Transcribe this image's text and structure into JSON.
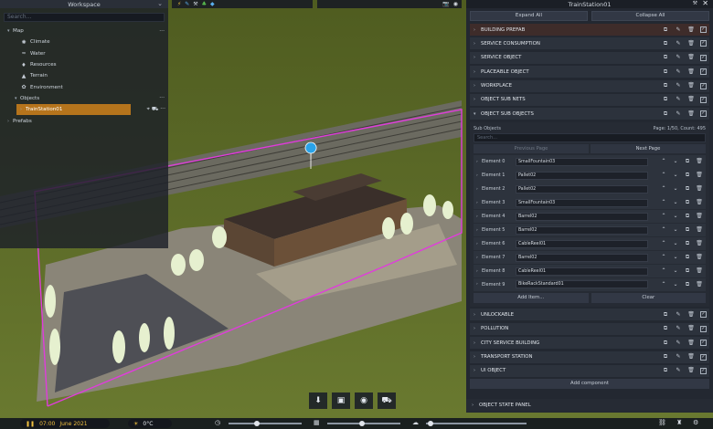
{
  "workspace": {
    "title": "Workspace",
    "search_placeholder": "Search...",
    "tree": [
      {
        "label": "Map",
        "level": 0,
        "arrow": "▾",
        "icon": ""
      },
      {
        "label": "Climate",
        "level": 1,
        "arrow": "",
        "icon": "sun-icon"
      },
      {
        "label": "Water",
        "level": 1,
        "arrow": "",
        "icon": "water-icon"
      },
      {
        "label": "Resources",
        "level": 1,
        "arrow": "",
        "icon": "resources-icon"
      },
      {
        "label": "Terrain",
        "level": 1,
        "arrow": "",
        "icon": "terrain-icon"
      },
      {
        "label": "Environment",
        "level": 1,
        "arrow": "",
        "icon": "environment-icon"
      },
      {
        "label": "Objects",
        "level": 1,
        "arrow": "▾",
        "icon": ""
      },
      {
        "label": "TrainStation01",
        "level": 2,
        "arrow": "›",
        "icon": "",
        "selected": true
      },
      {
        "label": "Prefabs",
        "level": 0,
        "arrow": "›",
        "icon": ""
      }
    ]
  },
  "inspector": {
    "title": "TrainStation01",
    "expand_all": "Expand All",
    "collapse_all": "Collapse All",
    "sections_top": [
      "BUILDING PREFAB",
      "SERVICE CONSUMPTION",
      "SERVICE OBJECT",
      "PLACEABLE OBJECT",
      "WORKPLACE",
      "OBJECT SUB NETS"
    ],
    "sub_objects": {
      "header": "OBJECT SUB OBJECTS",
      "title": "Sub Objects",
      "page_info": "Page: 1/50, Count: 495",
      "search_placeholder": "Search...",
      "previous_page": "Previous Page",
      "next_page": "Next Page",
      "elements": [
        {
          "label": "Element 0",
          "value": "SmallFountain03"
        },
        {
          "label": "Element 1",
          "value": "Pallet02"
        },
        {
          "label": "Element 2",
          "value": "Pallet02"
        },
        {
          "label": "Element 3",
          "value": "SmallFountain03"
        },
        {
          "label": "Element 4",
          "value": "Barrel02"
        },
        {
          "label": "Element 5",
          "value": "Barrel02"
        },
        {
          "label": "Element 6",
          "value": "CableReel01"
        },
        {
          "label": "Element 7",
          "value": "Barrel02"
        },
        {
          "label": "Element 8",
          "value": "CableReel01"
        },
        {
          "label": "Element 9",
          "value": "BikeRackStandard01"
        }
      ],
      "add_item": "Add Item...",
      "clear": "Clear"
    },
    "sections_bottom": [
      "UNLOCKABLE",
      "POLLUTION",
      "CITY SERVICE BUILDING",
      "TRANSPORT STATION",
      "UI OBJECT"
    ],
    "add_component": "Add component",
    "object_state_panel": "OBJECT STATE PANEL"
  },
  "bottom_bar": {
    "time": "07:00",
    "date": "June 2021",
    "temperature": "0°C"
  },
  "colors": {
    "selection": "#b5741c",
    "boundary": "#e03cdc",
    "marker": "#2aa3e8"
  }
}
